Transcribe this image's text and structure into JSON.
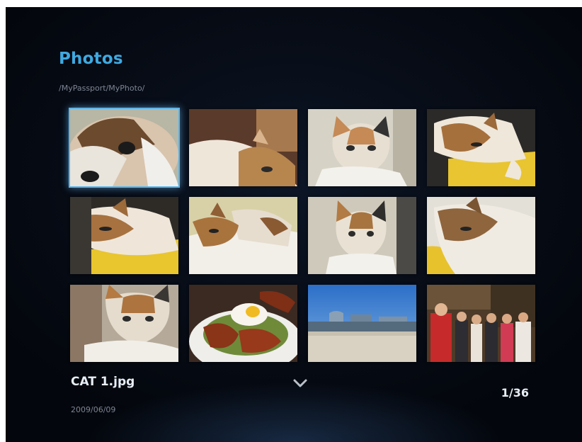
{
  "header": {
    "title": "Photos",
    "path": "/MyPassport/MyPhoto/"
  },
  "grid": {
    "selected_index": 0,
    "items": [
      {
        "name": "cat-photo-1"
      },
      {
        "name": "cat-photo-2"
      },
      {
        "name": "cat-photo-3"
      },
      {
        "name": "cat-photo-4"
      },
      {
        "name": "cat-photo-5"
      },
      {
        "name": "cat-photo-6"
      },
      {
        "name": "cat-photo-7"
      },
      {
        "name": "cat-photo-8"
      },
      {
        "name": "cat-photo-9"
      },
      {
        "name": "food-photo"
      },
      {
        "name": "beach-photo"
      },
      {
        "name": "group-photo"
      }
    ]
  },
  "footer": {
    "filename": "CAT 1.jpg",
    "date": "2009/06/09",
    "counter": "1/36",
    "scroll_icon": "chevron-down-icon"
  },
  "colors": {
    "accent": "#3fa9e0",
    "selection": "#5fb4e6"
  }
}
